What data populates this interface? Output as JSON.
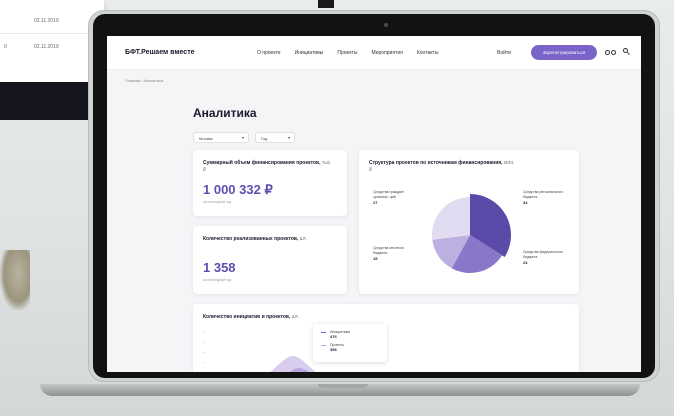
{
  "background": {
    "rows": [
      {
        "num": "",
        "date": "02.11.2019"
      },
      {
        "num": "0",
        "date": "02.11.2019"
      }
    ]
  },
  "header": {
    "logo": "БФТ.Решаем вместе",
    "nav": [
      "О проекте",
      "Инициативы",
      "Проекты",
      "Мероприятия",
      "Контакты"
    ],
    "login": "Войти",
    "cta": "Зарегистрироваться"
  },
  "breadcrumb": "Главная  /  Аналитика",
  "page": {
    "title": "Аналитика",
    "filters": [
      {
        "value": "Москва"
      },
      {
        "value": "Год"
      }
    ]
  },
  "cards": {
    "funding": {
      "title": "Суммарный объем финансирования проектов,",
      "unit": "тыс. ₽",
      "value": "1 000 332 ₽",
      "sub": "за последний год"
    },
    "projects": {
      "title": "Количество реализованных проектов,",
      "unit": "шт.",
      "value": "1 358",
      "sub": "за последний год"
    },
    "structure": {
      "title": "Структура проектов по источникам финансирования,",
      "unit": "млн. ₽"
    },
    "initiatives": {
      "title": "Количество инициатив и проектов,",
      "unit": "шт.",
      "tooltip": [
        {
          "label": "Инициативы",
          "value": "476"
        },
        {
          "label": "Проекты",
          "value": "356"
        }
      ]
    }
  },
  "pie_labels": {
    "left_top": {
      "text": "Средства граждан/ организа- ций",
      "value": "27"
    },
    "left_bottom": {
      "text": "Средства местного бюджета",
      "value": "15"
    },
    "right_top": {
      "text": "Средства регионального бюджета",
      "value": "34"
    },
    "right_bottom": {
      "text": "Средства федерального бюджета",
      "value": "24"
    }
  },
  "chart_data": {
    "type": "pie",
    "labels": [
      "Средства регионального бюджета",
      "Средства федерального бюджета",
      "Средства местного бюджета",
      "Средства граждан/ организаций"
    ],
    "values": [
      34,
      24,
      15,
      27
    ],
    "colors": [
      "#5b4aa8",
      "#8a77c9",
      "#bcb0e2",
      "#e2dcf2"
    ]
  },
  "colors": {
    "accent": "#7b64c9",
    "value": "#5a4fb0"
  }
}
